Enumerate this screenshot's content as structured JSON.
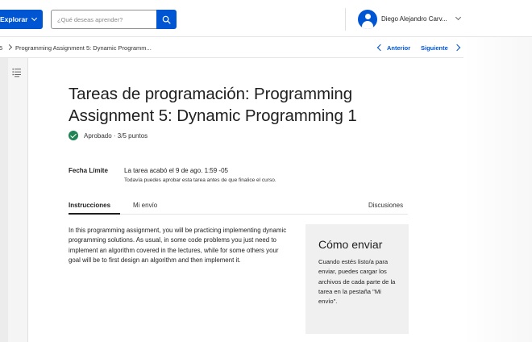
{
  "header": {
    "explore_label": "Explorar",
    "search_placeholder": "¿Qué deseas aprender?",
    "user_name": "Diego Alejandro Carv..."
  },
  "breadcrumb": {
    "number": "5",
    "current": "Programming Assignment 5: Dynamic Programm...",
    "prev_label": "Anterior",
    "next_label": "Siguiente"
  },
  "main": {
    "title": "Tareas de programación: Programming Assignment 5: Dynamic Programming 1",
    "status": "Aprobado · 3/5 puntos",
    "due_label": "Fecha Límite",
    "due_text": "La tarea acabó el 9 de ago. 1:59 -05",
    "due_note": "Todavía puedes aprobar esta tarea antes de que finalice el curso.",
    "tabs": [
      {
        "label": "Instrucciones",
        "active": true
      },
      {
        "label": "Mi envío",
        "active": false
      },
      {
        "label": "Discusiones",
        "active": false
      }
    ],
    "intro": "In this programming assignment, you will be practicing implementing dynamic programming solutions. As usual, in some code problems you just need to implement an algorithm covered in the lectures, while for some others your goal will be to first design an algorithm and then implement it."
  },
  "aside": {
    "title": "Cómo enviar",
    "body": "Cuando estés listo/a para enviar, puedes cargar los archivos de cada parte de la tarea en la pestaña \"Mi envío\"."
  },
  "colors": {
    "brand": "#0056d2",
    "success": "#1f8354"
  },
  "icons": [
    "chevron-down-icon",
    "search-icon",
    "avatar-user-icon",
    "chevron-right-icon",
    "chevron-left-icon",
    "table-of-contents-icon",
    "check-circle-icon"
  ]
}
